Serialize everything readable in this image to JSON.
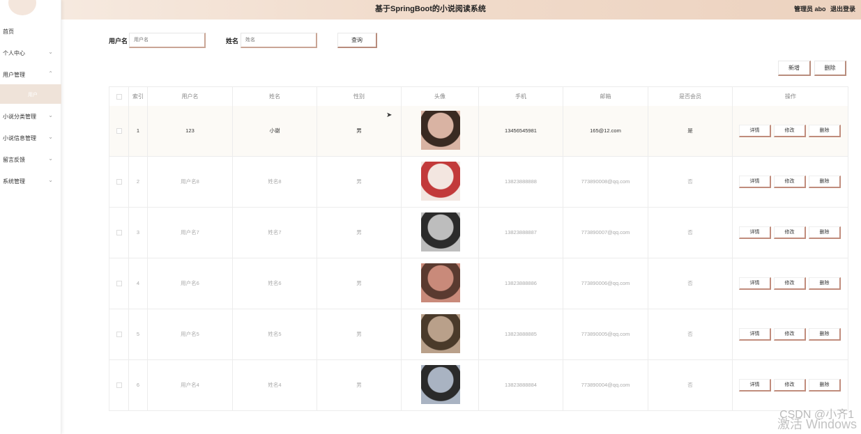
{
  "header": {
    "title": "基于SpringBoot的小说阅读系统",
    "user_role": "管理员 abo",
    "logout": "退出登录"
  },
  "sidebar": {
    "items": [
      {
        "label": "首页",
        "arrow": ""
      },
      {
        "label": "个人中心",
        "arrow": "⌄"
      },
      {
        "label": "用户管理",
        "arrow": "⌃"
      },
      {
        "label": "小说分类管理",
        "arrow": "⌄"
      },
      {
        "label": "小说信息管理",
        "arrow": "⌄"
      },
      {
        "label": "留言反馈",
        "arrow": "⌄"
      },
      {
        "label": "系统管理",
        "arrow": "⌄"
      }
    ],
    "active_sub": "用户"
  },
  "search": {
    "username_label": "用户名",
    "username_placeholder": "用户名",
    "name_label": "姓名",
    "name_placeholder": "姓名",
    "query_button": "查询"
  },
  "actions": {
    "add": "新增",
    "delete": "删除"
  },
  "table": {
    "headers": [
      "",
      "索引",
      "用户名",
      "姓名",
      "性别",
      "头像",
      "手机",
      "邮箱",
      "是否会员",
      "操作"
    ],
    "rows": [
      {
        "index": "1",
        "username": "123",
        "name": "小谢",
        "gender": "男",
        "phone": "13456545981",
        "email": "165@12.com",
        "member": "是"
      },
      {
        "index": "2",
        "username": "用户名8",
        "name": "姓名8",
        "gender": "男",
        "phone": "13823888888",
        "email": "773890008@qq.com",
        "member": "否"
      },
      {
        "index": "3",
        "username": "用户名7",
        "name": "姓名7",
        "gender": "男",
        "phone": "13823888887",
        "email": "773890007@qq.com",
        "member": "否"
      },
      {
        "index": "4",
        "username": "用户名6",
        "name": "姓名6",
        "gender": "男",
        "phone": "13823888886",
        "email": "773890006@qq.com",
        "member": "否"
      },
      {
        "index": "5",
        "username": "用户名5",
        "name": "姓名5",
        "gender": "男",
        "phone": "13823888885",
        "email": "773890005@qq.com",
        "member": "否"
      },
      {
        "index": "6",
        "username": "用户名4",
        "name": "姓名4",
        "gender": "男",
        "phone": "13823888884",
        "email": "773890004@qq.com",
        "member": "否"
      }
    ],
    "row_actions": {
      "detail": "详情",
      "edit": "修改",
      "delete": "删除"
    }
  },
  "overlay": {
    "csdn": "CSDN @小齐1",
    "activate": "激活 Windows"
  }
}
